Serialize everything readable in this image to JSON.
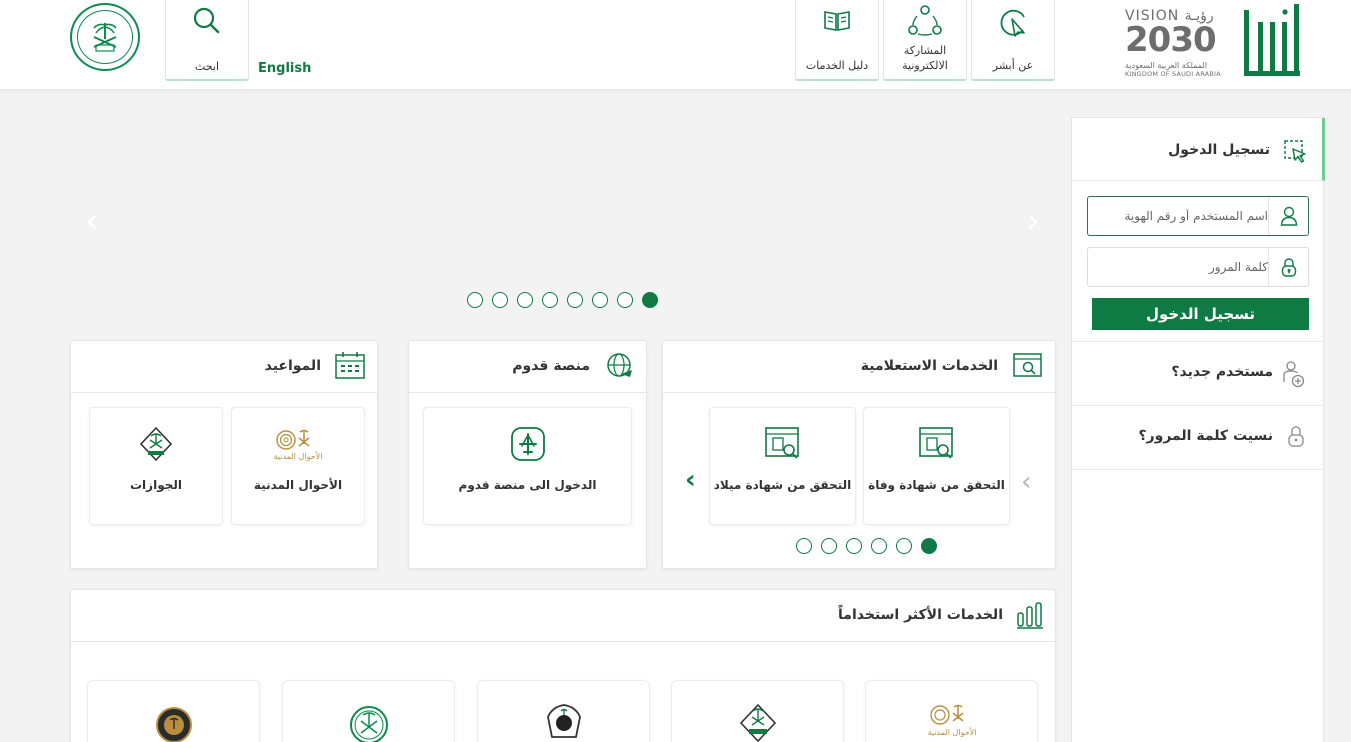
{
  "header": {
    "search_label": "ابحث",
    "language_link": "English",
    "nav": [
      {
        "label": "دليل الخدمات",
        "icon": "book-icon"
      },
      {
        "label": "المشاركة الالكترونية",
        "icon": "network-icon"
      },
      {
        "label": "عن أبشر",
        "icon": "pointer-icon"
      }
    ],
    "vision": {
      "top": "VISION رؤيـة",
      "year": "2030",
      "arabic": "المملكة العربية السعودية",
      "english": "KINGDOM OF SAUDI ARABIA"
    },
    "brand": "أبشر"
  },
  "slider": {
    "dots": 8,
    "active_index": 7
  },
  "inquiry": {
    "title": "الخدمات الاستعلامية",
    "tiles": [
      {
        "label": "التحقق من شهادة وفاة",
        "icon": "certificate-search-icon"
      },
      {
        "label": "التحقق من شهادة ميلاد",
        "icon": "certificate-search-icon"
      }
    ],
    "dots": 6,
    "active_index": 5
  },
  "arrival": {
    "title": "منصة قدوم",
    "tile_label": "الدخول الى منصة قدوم"
  },
  "appointments": {
    "title": "المواعيد",
    "tiles": [
      {
        "label": "الأحوال المدنية",
        "logo_text": "الأحوال المدنية"
      },
      {
        "label": "الجوازات"
      }
    ]
  },
  "most_used": {
    "title": "الخدمات الأكثر استخداماً",
    "logo_text": "الأحوال المدنية"
  },
  "login": {
    "title": "تسجيل الدخول",
    "username_placeholder": "اسم المستخدم أو رقم الهوية",
    "password_placeholder": "كلمة المرور",
    "button": "تسجيل الدخول",
    "new_user": "مستخدم جديد؟",
    "forgot_password": "نسيت كلمة المرور؟"
  },
  "colors": {
    "brand_green": "#0f7a44",
    "accent_green": "#6ccf8c",
    "background": "#f3f3f3"
  }
}
